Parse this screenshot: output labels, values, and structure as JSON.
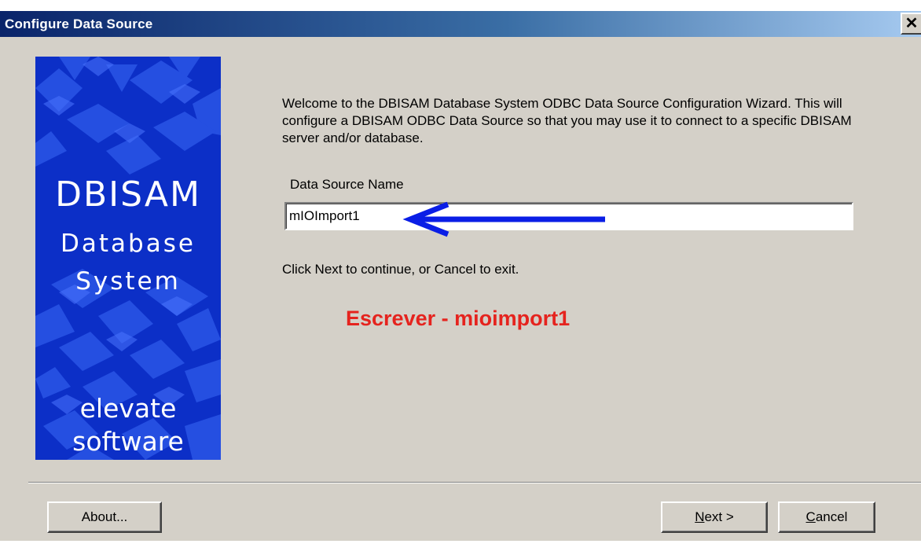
{
  "window": {
    "title": "Configure Data Source",
    "close_glyph": "✕"
  },
  "banner": {
    "line1": "DBISAM",
    "line2": "Database",
    "line3": "System",
    "line4": "elevate",
    "line5": "software",
    "colors": {
      "background": "#0c2fc7",
      "shape": "#2a55e6",
      "text": "#ffffff"
    }
  },
  "welcome_text": "Welcome to the DBISAM Database System ODBC Data Source Configuration Wizard.  This will configure a DBISAM ODBC Data Source so that you may use it to connect to a specific DBISAM server and/or database.",
  "data_source": {
    "label": "Data Source Name",
    "value": "mIOImport1"
  },
  "hint_text": "Click Next to continue, or Cancel to exit.",
  "annotation": {
    "text": "Escrever - mioimport1",
    "color": "#e5231e",
    "arrow_icon": "left-arrow-icon",
    "arrow_color": "#0a1ee6"
  },
  "buttons": {
    "about": "About...",
    "next_accel": "N",
    "next_rest": "ext >",
    "cancel_accel": "C",
    "cancel_rest": "ancel"
  }
}
